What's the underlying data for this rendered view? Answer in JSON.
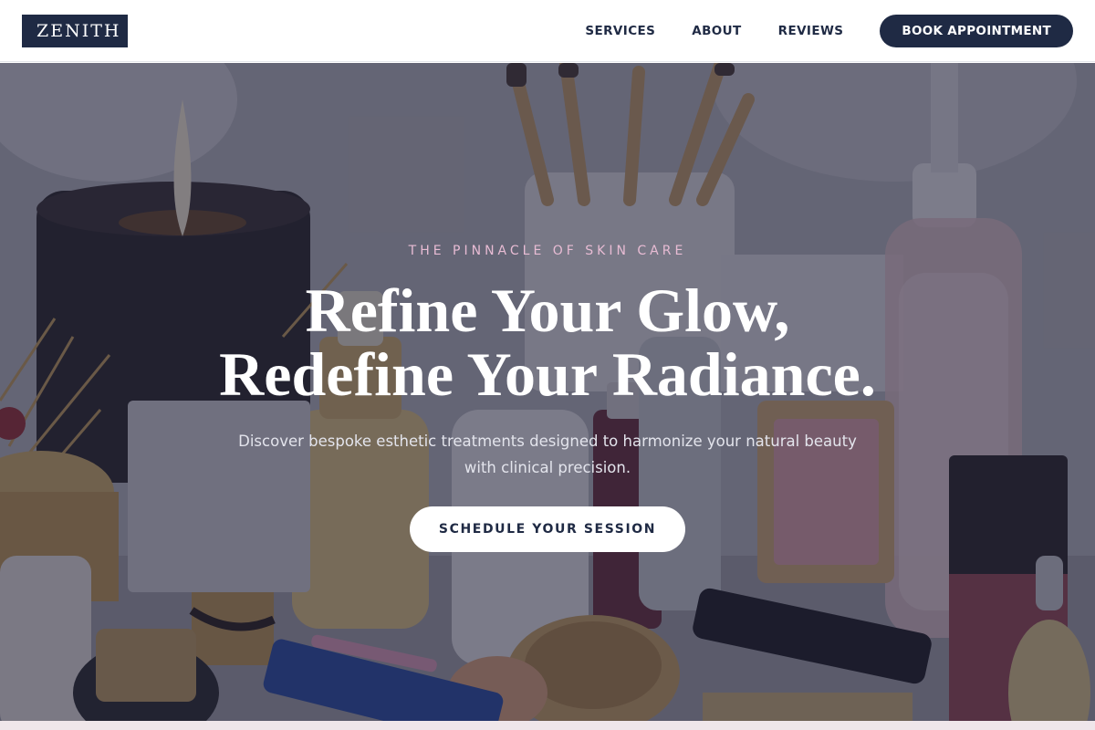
{
  "header": {
    "logo": "ZENITH",
    "nav": [
      {
        "label": "SERVICES"
      },
      {
        "label": "ABOUT"
      },
      {
        "label": "REVIEWS"
      }
    ],
    "cta_label": "BOOK APPOINTMENT"
  },
  "hero": {
    "eyebrow": "THE PINNACLE OF SKIN CARE",
    "headline_line1": "Refine Your Glow,",
    "headline_line2": "Redefine Your Radiance.",
    "subtext": "Discover bespoke esthetic treatments designed to harmonize your natural beauty with clinical precision.",
    "cta_label": "SCHEDULE YOUR SESSION",
    "background_image": "cosmetics-vanity-photo"
  },
  "colors": {
    "brand_navy": "#1f2a44",
    "eyebrow_pink": "#e8bcd4",
    "overlay": "#1c1e34"
  }
}
